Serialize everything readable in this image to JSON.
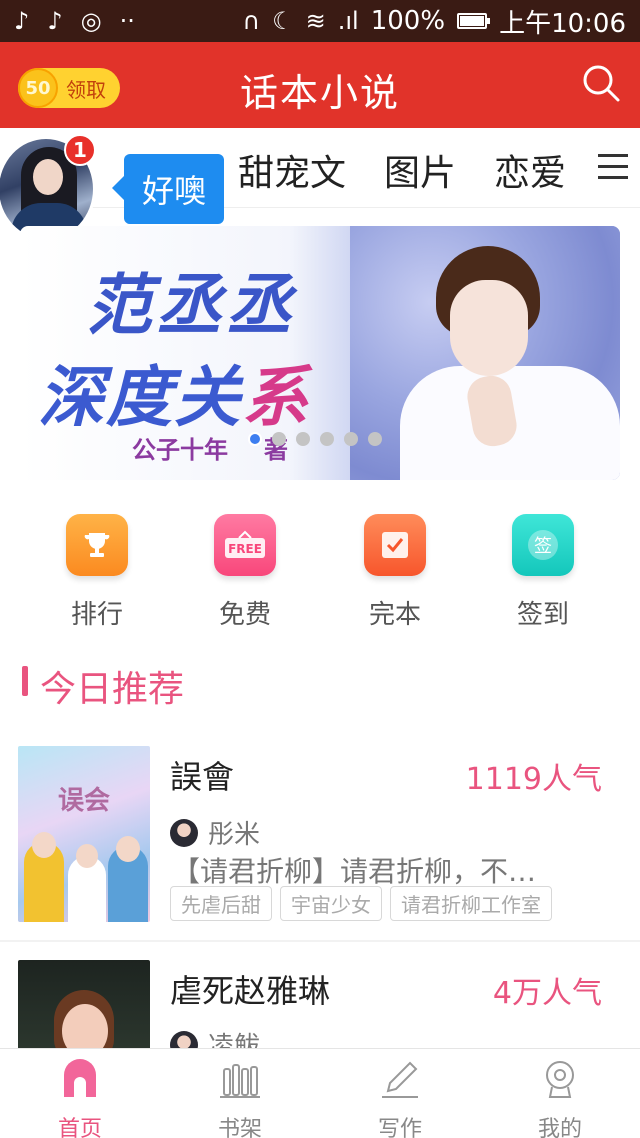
{
  "status_bar": {
    "left_icons": [
      "tiktok-icon",
      "tiktok-icon",
      "chrome-icon",
      "more-icon"
    ],
    "battery": "100%",
    "time": "上午10:06"
  },
  "header": {
    "coin_value": "50",
    "coin_label": "领取",
    "title": "话本小说"
  },
  "tabs": [
    "甜宠文",
    "图片",
    "恋爱"
  ],
  "avatar": {
    "badge": "1",
    "bubble_text": "好噢"
  },
  "banner": {
    "title_line1": "范丞丞",
    "title_line2_blue": "深度关",
    "title_line2_pink": "系",
    "author": "公子十年",
    "author_suffix": "著",
    "slide_count": 6,
    "active_slide": 0
  },
  "quick_actions": [
    {
      "label": "排行",
      "icon": "trophy-icon",
      "color": "#fb9a2f"
    },
    {
      "label": "免费",
      "icon": "free-icon",
      "color": "#fa5a8a"
    },
    {
      "label": "完本",
      "icon": "check-note-icon",
      "color": "#fa6b3c"
    },
    {
      "label": "签到",
      "icon": "signin-icon",
      "color": "#1fd5c8"
    }
  ],
  "section": {
    "title": "今日推荐"
  },
  "books": [
    {
      "name": "誤會",
      "popularity": "1119人气",
      "author": "彤米",
      "desc": "【请君折柳】请君折柳，不…",
      "tags": [
        "先虐后甜",
        "宇宙少女",
        "请君折柳工作室"
      ],
      "cover_text": "误会"
    },
    {
      "name": "虐死赵雅琳",
      "popularity": "4万人气",
      "author": "凌鲅"
    }
  ],
  "bottom_nav": [
    {
      "label": "首页",
      "icon": "home-icon",
      "active": true
    },
    {
      "label": "书架",
      "icon": "bookshelf-icon",
      "active": false
    },
    {
      "label": "写作",
      "icon": "pen-icon",
      "active": false
    },
    {
      "label": "我的",
      "icon": "profile-icon",
      "active": false
    }
  ],
  "colors": {
    "header_red": "#e1332a",
    "accent_pink": "#e9547f",
    "bubble_blue": "#1e8cf0"
  }
}
